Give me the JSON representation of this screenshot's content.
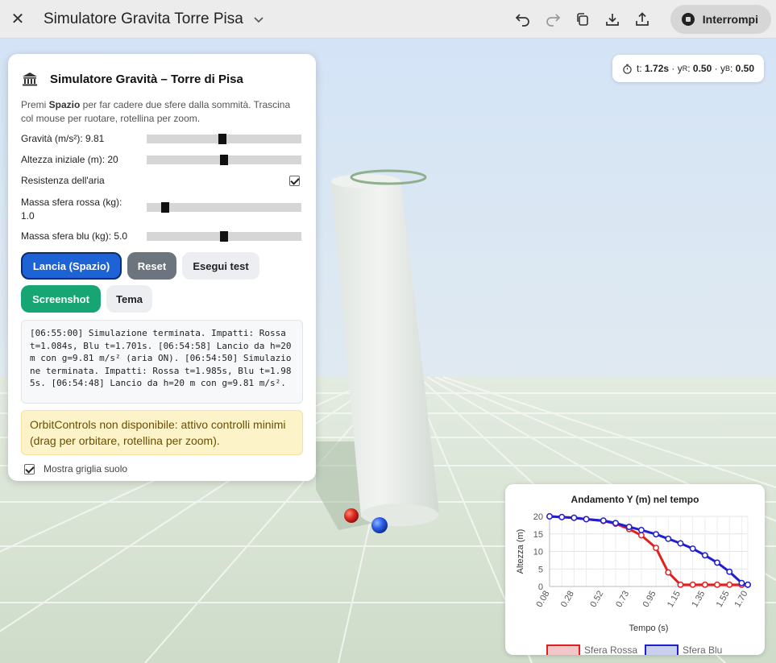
{
  "topbar": {
    "title": "Simulatore Gravita Torre Pisa",
    "stop_label": "Interrompi"
  },
  "hud": {
    "t_label": "t:",
    "t_value": "1.72s",
    "sep": "·",
    "yr_label": "y",
    "yr_sub": "R",
    "yr_value": "0.50",
    "yb_label": "y",
    "yb_sub": "B",
    "yb_value": "0.50"
  },
  "panel": {
    "title": "Simulatore Gravità – Torre di Pisa",
    "desc_pre": "Premi ",
    "desc_key": "Spazio",
    "desc_post": " per far cadere due sfere dalla sommità. Trascina col mouse per ruotare, rotellina per zoom.",
    "gravity": {
      "label": "Gravità (m/s²): 9.81",
      "value": 9.81,
      "min": 0,
      "max": 20
    },
    "height": {
      "label": "Altezza iniziale (m): 20",
      "value": 20,
      "min": 0,
      "max": 40
    },
    "air": {
      "label": "Resistenza dell'aria",
      "checked": true
    },
    "mass_red": {
      "label_line1": "Massa sfera rossa (kg):",
      "label_line2": "1.0",
      "value": 1.0,
      "min": 0,
      "max": 10
    },
    "mass_blue": {
      "label": "Massa sfera blu (kg): 5.0",
      "value": 5.0,
      "min": 0,
      "max": 10
    },
    "buttons": {
      "launch": "Lancia (Spazio)",
      "reset": "Reset",
      "test": "Esegui test",
      "screenshot": "Screenshot",
      "theme": "Tema"
    },
    "log": "[06:55:00] Simulazione terminata. Impatti: Rossa t=1.084s, Blu t=1.701s. [06:54:58] Lancio da h=20 m con g=9.81 m/s² (aria ON). [06:54:50] Simulazione terminata. Impatti: Rossa t=1.985s, Blu t=1.985s. [06:54:48] Lancio da h=20 m con g=9.81 m/s².",
    "warning": "OrbitControls non disponibile: attivo controlli minimi (drag per orbitare, rotellina per zoom).",
    "grid_toggle": {
      "label": "Mostra griglia suolo",
      "checked": true
    }
  },
  "colors": {
    "red_series": "#e02020",
    "blue_series": "#1f1fd0",
    "primary": "#1e63d6",
    "success": "#17a673"
  },
  "chart_data": {
    "type": "line",
    "title": "Andamento Y (m) nel tempo",
    "xlabel": "Tempo (s)",
    "ylabel": "Altezza (m)",
    "ylim": [
      0,
      20
    ],
    "yticks": [
      0,
      5,
      10,
      15,
      20
    ],
    "x": [
      0.08,
      0.18,
      0.28,
      0.38,
      0.52,
      0.62,
      0.73,
      0.83,
      0.95,
      1.05,
      1.15,
      1.25,
      1.35,
      1.45,
      1.55,
      1.65,
      1.7
    ],
    "xtick_labels": [
      "0.08",
      "0.28",
      "0.52",
      "0.73",
      "0.95",
      "1.15",
      "1.35",
      "1.55",
      "1.70"
    ],
    "series": [
      {
        "name": "Sfera Rossa",
        "color": "#e02020",
        "values": [
          20,
          19.8,
          19.6,
          19.2,
          18.7,
          17.9,
          16.4,
          14.6,
          11.0,
          4.0,
          0.5,
          0.5,
          0.5,
          0.5,
          0.5,
          0.5,
          0.5
        ]
      },
      {
        "name": "Sfera Blu",
        "color": "#1f1fd0",
        "values": [
          20,
          19.8,
          19.6,
          19.2,
          18.8,
          18.1,
          17.0,
          16.1,
          14.9,
          13.6,
          12.3,
          10.8,
          8.9,
          6.8,
          4.2,
          1.0,
          0.5
        ]
      }
    ],
    "grid": true,
    "legend": "bottom"
  }
}
